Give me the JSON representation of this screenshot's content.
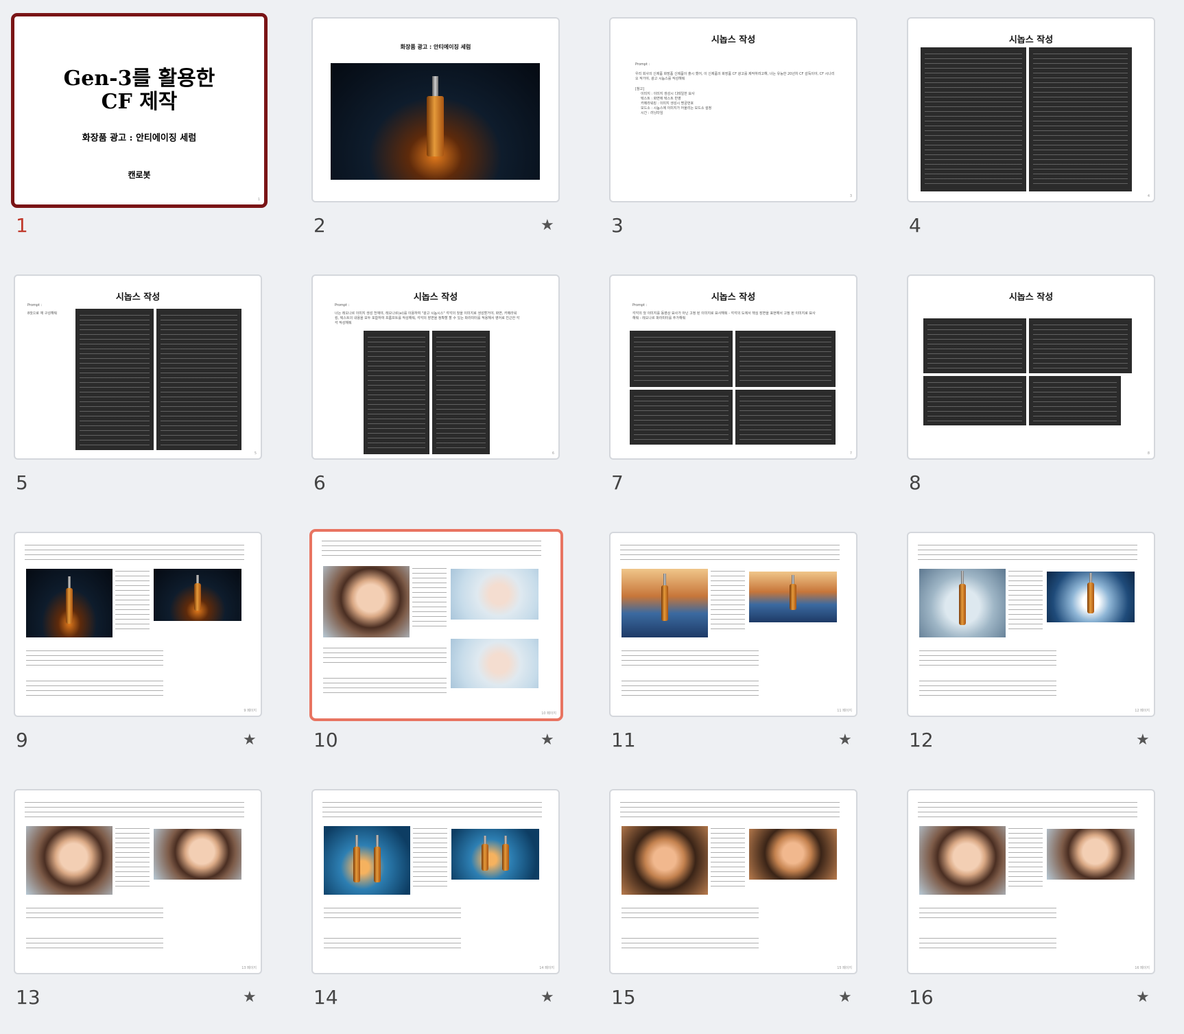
{
  "slides": [
    {
      "number": "1",
      "selected": true,
      "title_line1": "Gen-3를 활용한",
      "title_line2": "CF 제작",
      "subtitle": "화장품 광고 : 안티에이징 세럼",
      "author": "캔로봇",
      "page": "1"
    },
    {
      "number": "2",
      "title": "화장품 광고 : 안티에이징 세럼",
      "starred": true
    },
    {
      "number": "3",
      "title": "시놉스 작성",
      "prompt_label": "Prompt :",
      "body": "우리 회사의 신제품 화장품 신제품이 출시 했어, 이 신제품의 화장품 CF 광고를 제작하려고해, 너는 유능한 20년차 CF 감독이야, CF 시나리오 작가야, 광고 시놉스를 작성해줘",
      "ref_label": "[참고]",
      "refs": [
        "이미지 : 이미지 생성시 디테일한 묘사",
        "텍스트 : 화면에 텍스트 반영",
        "카메라워킹 : 이미지 생성시 명궁번호",
        "모드소 : 시놉스에 이미지가 어울리는 모드소 설정",
        "시간 : 러닝타임"
      ],
      "page": "3"
    },
    {
      "number": "4",
      "title": "시놉스 작성",
      "page": "4"
    },
    {
      "number": "5",
      "title": "시놉스 작성",
      "prompt_label": "Prompt :",
      "body": "8컷으로 재 구성해줘",
      "page": "5"
    },
    {
      "number": "6",
      "title": "시놉스 작성",
      "prompt_label": "Prompt :",
      "body": "너는 레오나르 이미지 생성 천재야, 레오나르(ai)를 이용하여 \"광고 시놉시스\" 각각의 컷을 이미지로 생성할거야, 화면, 카메라워킹, 텍스트의 내용을 모두 포함하여 프롬프트를 작성해줘, 각각의 장면을 정확할 할 수 있는 파라미터를 적용해서 영어로 친근한 각각 작성해줘",
      "page": "6"
    },
    {
      "number": "7",
      "title": "시놉스 작성",
      "prompt_label": "Prompt :",
      "body": "각각의 컷 이미지를 동영상 묘사가 아닌 고정 된 이미지로 묘사해줘 - 각각의 도에서 핵심 장면을 표현해서 고정 된 이미지로 묘사해줘 - 레오나르 파라미터를 추가해줘",
      "page": "7"
    },
    {
      "number": "8",
      "title": "시놉스 작성",
      "page": "8"
    },
    {
      "number": "9",
      "starred": true,
      "page": "9 페이지"
    },
    {
      "number": "10",
      "hover": true,
      "starred": true,
      "page": "10 페이지"
    },
    {
      "number": "11",
      "starred": true,
      "page": "11 페이지"
    },
    {
      "number": "12",
      "starred": true,
      "page": "12 페이지"
    },
    {
      "number": "13",
      "starred": true,
      "page": "13 페이지"
    },
    {
      "number": "14",
      "starred": true,
      "page": "14 페이지"
    },
    {
      "number": "15",
      "starred": true,
      "page": "15 페이지"
    },
    {
      "number": "16",
      "starred": true,
      "page": "16 페이지"
    }
  ],
  "star_glyph": "★",
  "colors": {
    "selected_border": "#7a1416",
    "hover_border": "#e87461",
    "background": "#eef0f3"
  }
}
